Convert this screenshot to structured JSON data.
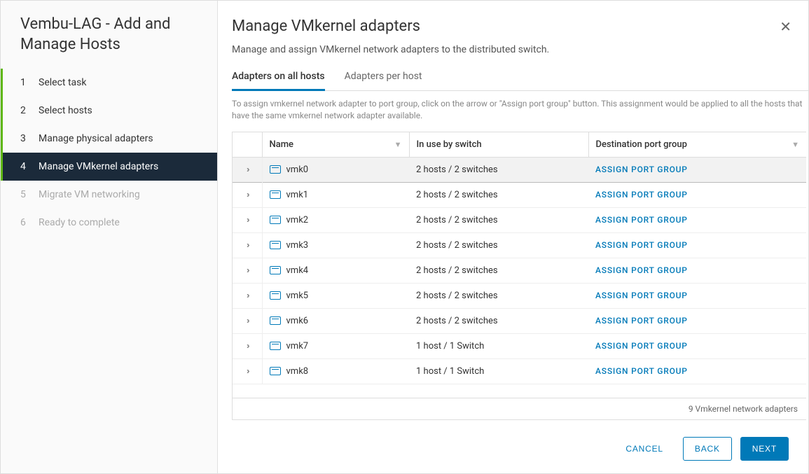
{
  "sidebar": {
    "title": "Vembu-LAG - Add and Manage Hosts",
    "steps": [
      {
        "num": "1",
        "label": "Select task",
        "state": "completed"
      },
      {
        "num": "2",
        "label": "Select hosts",
        "state": "completed"
      },
      {
        "num": "3",
        "label": "Manage physical adapters",
        "state": "completed"
      },
      {
        "num": "4",
        "label": "Manage VMkernel adapters",
        "state": "active"
      },
      {
        "num": "5",
        "label": "Migrate VM networking",
        "state": "pending"
      },
      {
        "num": "6",
        "label": "Ready to complete",
        "state": "pending"
      }
    ]
  },
  "main": {
    "title": "Manage VMkernel adapters",
    "subtitle": "Manage and assign VMkernel network adapters to the distributed switch.",
    "tabs": [
      {
        "label": "Adapters on all hosts",
        "active": true
      },
      {
        "label": "Adapters per host",
        "active": false
      }
    ],
    "instruction": "To assign vmkernel network adapter to port group, click on the arrow or \"Assign port group\" button. This assignment would be applied to all the hosts that have the same vmkernel network adapter available.",
    "table": {
      "headers": {
        "name": "Name",
        "in_use": "In use by switch",
        "dest": "Destination port group"
      },
      "rows": [
        {
          "name": "vmk0",
          "in_use": "2 hosts / 2 switches",
          "action": "ASSIGN PORT GROUP",
          "selected": true
        },
        {
          "name": "vmk1",
          "in_use": "2 hosts / 2 switches",
          "action": "ASSIGN PORT GROUP",
          "selected": false
        },
        {
          "name": "vmk2",
          "in_use": "2 hosts / 2 switches",
          "action": "ASSIGN PORT GROUP",
          "selected": false
        },
        {
          "name": "vmk3",
          "in_use": "2 hosts / 2 switches",
          "action": "ASSIGN PORT GROUP",
          "selected": false
        },
        {
          "name": "vmk4",
          "in_use": "2 hosts / 2 switches",
          "action": "ASSIGN PORT GROUP",
          "selected": false
        },
        {
          "name": "vmk5",
          "in_use": "2 hosts / 2 switches",
          "action": "ASSIGN PORT GROUP",
          "selected": false
        },
        {
          "name": "vmk6",
          "in_use": "2 hosts / 2 switches",
          "action": "ASSIGN PORT GROUP",
          "selected": false
        },
        {
          "name": "vmk7",
          "in_use": "1 host / 1 Switch",
          "action": "ASSIGN PORT GROUP",
          "selected": false
        },
        {
          "name": "vmk8",
          "in_use": "1 host / 1 Switch",
          "action": "ASSIGN PORT GROUP",
          "selected": false
        }
      ],
      "footer": "9 Vmkernel network adapters"
    }
  },
  "actions": {
    "cancel": "CANCEL",
    "back": "BACK",
    "next": "NEXT"
  }
}
